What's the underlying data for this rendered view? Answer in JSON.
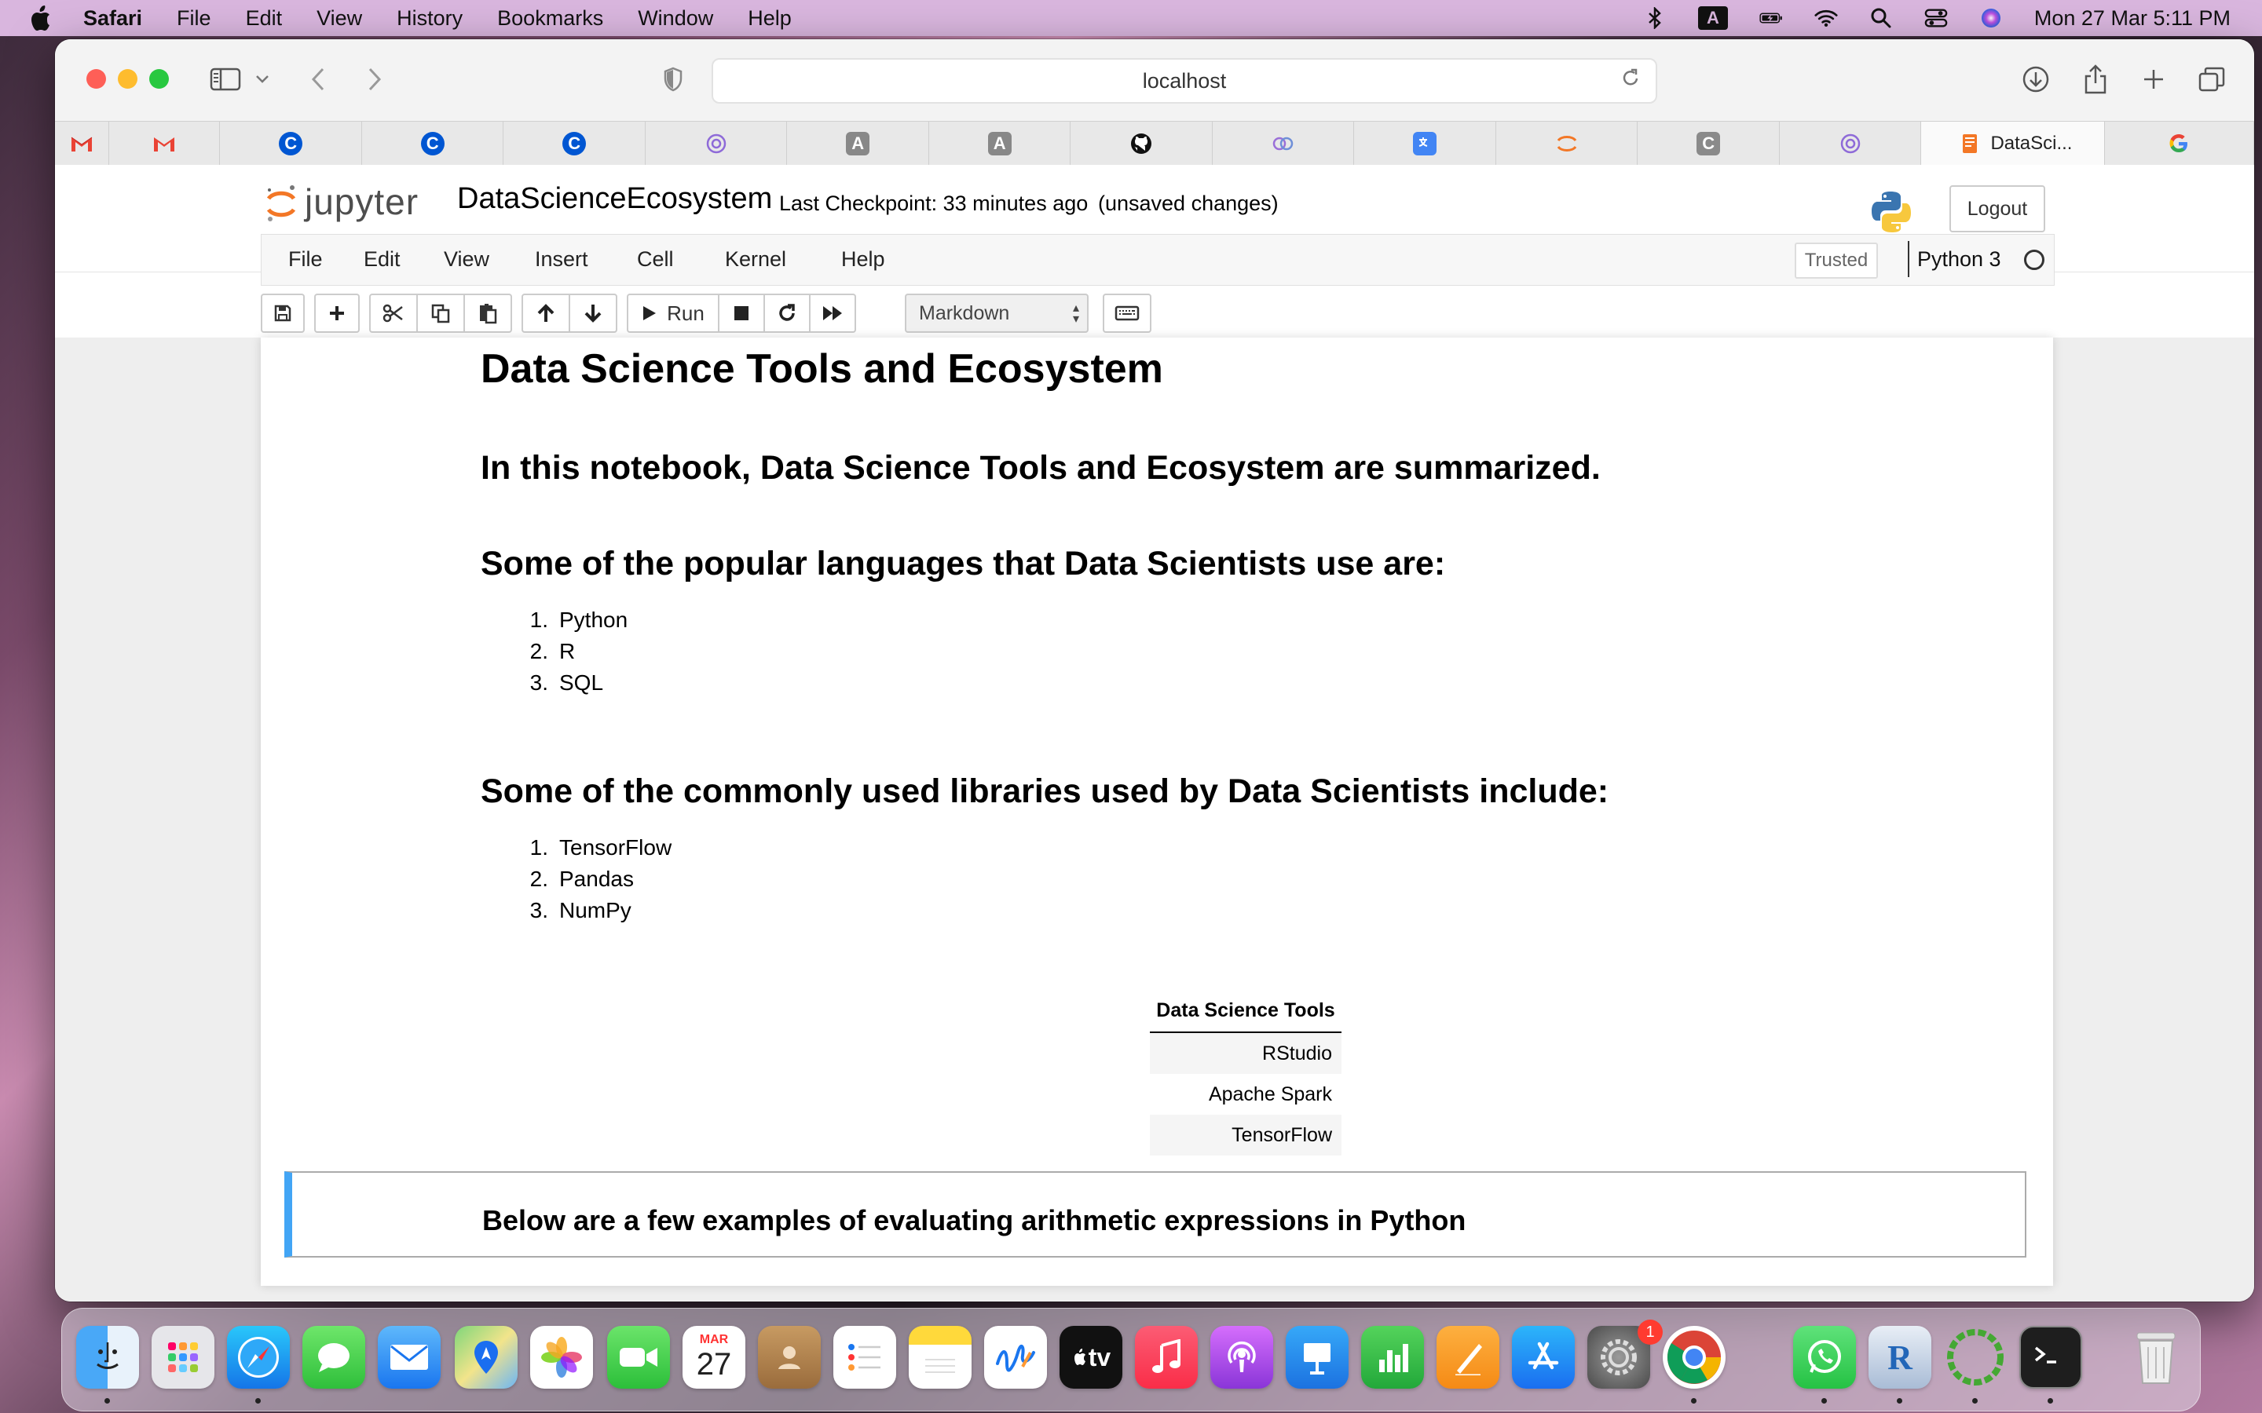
{
  "menubar": {
    "app": "Safari",
    "items": [
      "File",
      "Edit",
      "View",
      "History",
      "Bookmarks",
      "Window",
      "Help"
    ],
    "clock": "Mon 27 Mar  5:11 PM",
    "status_icons": [
      "bluetooth-icon",
      "input-source-icon",
      "battery-icon",
      "wifi-icon",
      "spotlight-search-icon",
      "control-center-icon",
      "siri-icon"
    ],
    "input_source_letter": "A"
  },
  "browser": {
    "url": "localhost",
    "tabs": [
      {
        "icon": "gmail-icon"
      },
      {
        "icon": "gmail-icon"
      },
      {
        "icon": "coursera-icon",
        "letter": "C"
      },
      {
        "icon": "coursera-icon",
        "letter": "C"
      },
      {
        "icon": "coursera-icon",
        "letter": "C"
      },
      {
        "icon": "openai-icon"
      },
      {
        "icon": "a-letter-icon",
        "letter": "A"
      },
      {
        "icon": "a-letter-icon",
        "letter": "A"
      },
      {
        "icon": "github-icon"
      },
      {
        "icon": "ibm-icon"
      },
      {
        "icon": "google-translate-icon"
      },
      {
        "icon": "jupyter-icon"
      },
      {
        "icon": "c-letter-icon",
        "letter": "C"
      },
      {
        "icon": "openai-icon"
      },
      {
        "icon": "jupyter-notebook-icon",
        "label": "DataSci..."
      },
      {
        "icon": "google-icon",
        "letter": "G"
      }
    ]
  },
  "jupyter": {
    "logo_text": "jupyter",
    "notebook_name": "DataScienceEcosystem",
    "checkpoint": "Last Checkpoint: 33 minutes ago",
    "unsaved": "(unsaved changes)",
    "logout": "Logout",
    "menu": [
      "File",
      "Edit",
      "View",
      "Insert",
      "Cell",
      "Kernel",
      "Help"
    ],
    "trusted": "Trusted",
    "kernel": "Python 3",
    "run_label": "Run",
    "cell_type": "Markdown"
  },
  "notebook": {
    "title": "Data Science Tools and Ecosystem",
    "intro": "In this notebook, Data Science Tools and Ecosystem are summarized.",
    "languages_heading": "Some of the popular languages that Data Scientists use are:",
    "languages": [
      "Python",
      "R",
      "SQL"
    ],
    "libraries_heading": "Some of the commonly used libraries used by Data Scientists include:",
    "libraries": [
      "TensorFlow",
      "Pandas",
      "NumPy"
    ],
    "tools_table": {
      "header": "Data Science Tools",
      "rows": [
        "RStudio",
        "Apache Spark",
        "TensorFlow"
      ]
    },
    "selected_cell_text": "Below are a few examples of evaluating arithmetic expressions in Python"
  },
  "dock": {
    "calendar_month": "MAR",
    "calendar_day": "27",
    "settings_badge": "1",
    "tv_label": "tv",
    "r_letter": "R"
  }
}
